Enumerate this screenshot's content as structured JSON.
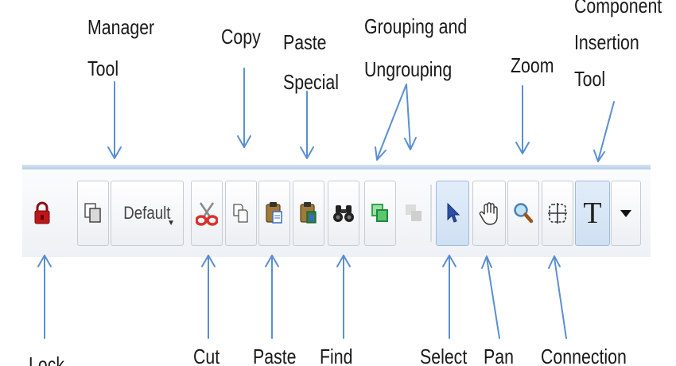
{
  "labels": {
    "manager_tool": "Manager\nTool",
    "copy": "Copy",
    "paste_special": "Paste\nSpecial",
    "grouping": "Grouping and\nUngrouping",
    "zoom": "Zoom",
    "component_insertion": "Component\nInsertion\nTool",
    "lock": "Lock",
    "cut": "Cut",
    "paste": "Paste",
    "find": "Find",
    "select": "Select",
    "pan": "Pan",
    "connection": "Connection"
  },
  "toolbar": {
    "default_select_value": "Default",
    "text_tool_glyph": "T"
  },
  "icons": {
    "lock": "lock-icon",
    "manager": "manager-icon",
    "cut": "scissors-icon",
    "copy": "copy-icon",
    "paste": "paste-icon",
    "paste_special": "paste-special-icon",
    "find": "binoculars-icon",
    "group": "group-icon",
    "ungroup": "ungroup-icon",
    "select": "pointer-icon",
    "pan": "hand-icon",
    "zoom": "magnifier-icon",
    "connection": "connection-icon",
    "component_insertion": "text-tool-icon",
    "dropdown": "dropdown-arrow-icon"
  },
  "colors": {
    "arrow": "#5b8fd0",
    "toolbar_border": "#b7cde8",
    "lock_red": "#c0151b",
    "scissors_red": "#d8322f",
    "group_green": "#2aa84a"
  }
}
